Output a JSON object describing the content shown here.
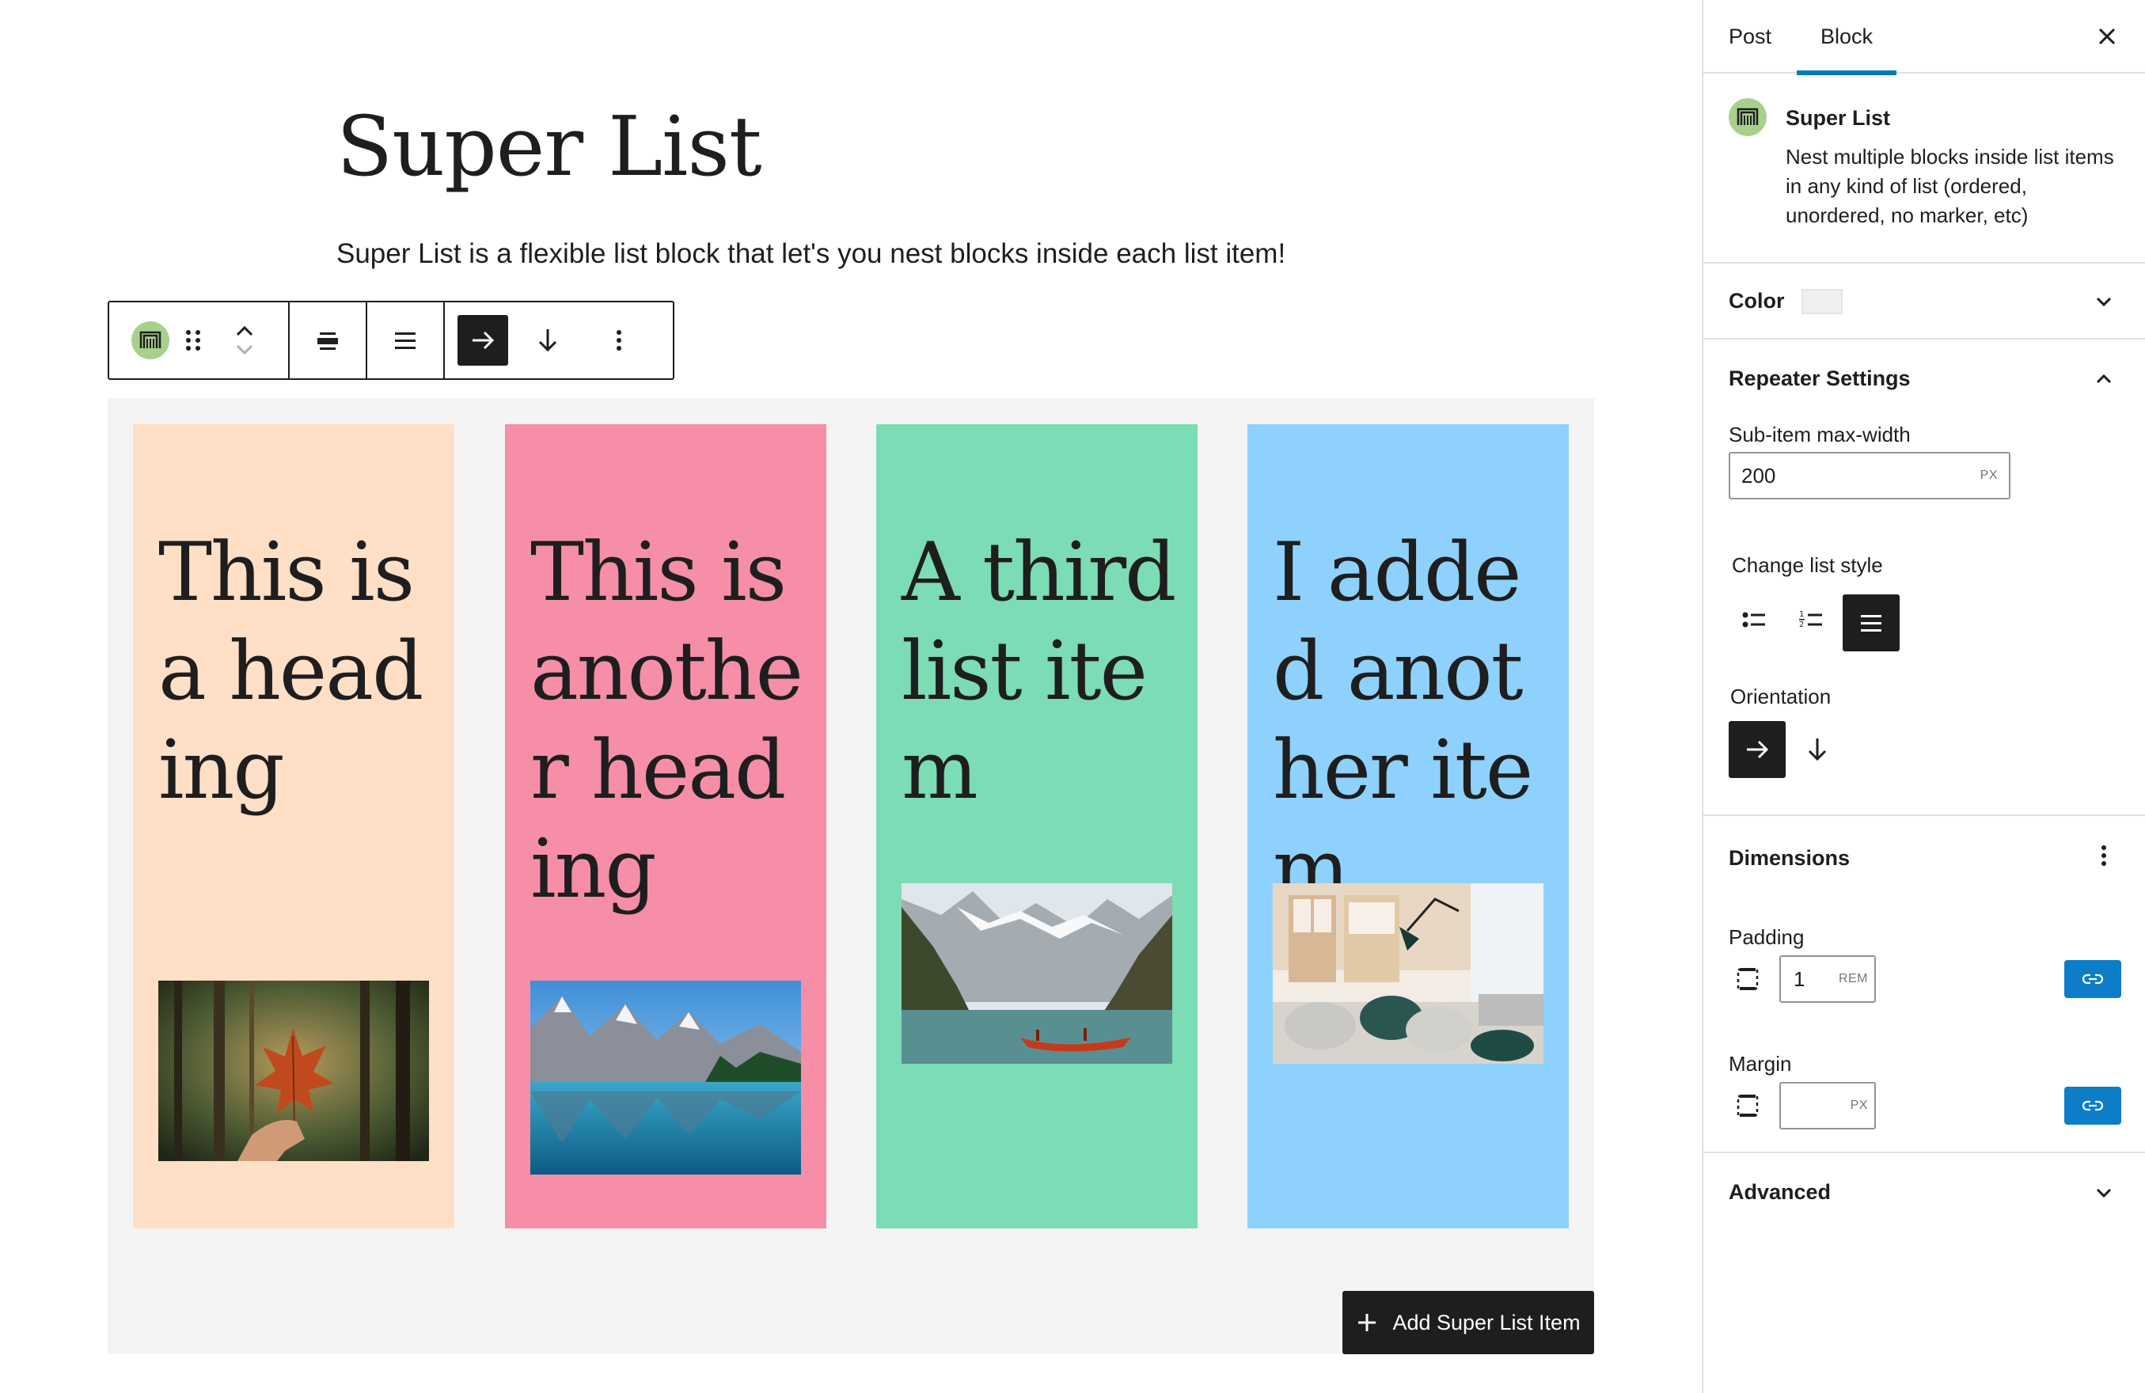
{
  "post": {
    "title": "Super List",
    "intro": "Super List is a flexible list block that let's you nest blocks inside each list item!"
  },
  "toolbar": {
    "block_icon": "super-list-icon",
    "buttons": [
      "drag-handle-icon",
      "move-up-icon",
      "move-down-icon",
      "align-icon",
      "list-style-icon",
      "orientation-horizontal-icon",
      "orientation-vertical-icon",
      "more-options-icon"
    ],
    "active_orientation": "horizontal"
  },
  "list_items": [
    {
      "heading": "This is a heading",
      "background": "#ffdfc6",
      "image": "autumn maple leaf held in hand in forest"
    },
    {
      "heading": "This is another heading",
      "background": "#f68ea8",
      "image": "mountain lake reflection"
    },
    {
      "heading": "A third list item",
      "background": "#7bdcb5",
      "image": "red canoe on mountain lake"
    },
    {
      "heading": "I added another item",
      "background": "#8ed1fc",
      "image": "bright interior with chairs and lamp"
    }
  ],
  "add_button": {
    "label": "Add Super List Item",
    "icon": "plus-icon"
  },
  "sidebar": {
    "tabs": [
      {
        "label": "Post",
        "active": false
      },
      {
        "label": "Block",
        "active": true
      }
    ],
    "close_icon": "close-icon",
    "block_card": {
      "title": "Super List",
      "description": "Nest multiple blocks inside list items in any kind of list (ordered, unordered, no marker, etc)"
    },
    "color_panel": {
      "label": "Color",
      "swatch": "#f0f0f0"
    },
    "repeater": {
      "label": "Repeater Settings",
      "max_width_label": "Sub-item max-width",
      "max_width_value": "200",
      "max_width_unit": "PX",
      "list_style_label": "Change list style",
      "list_styles": [
        "unordered-list-icon",
        "ordered-list-icon",
        "no-marker-list-icon"
      ],
      "active_list_style": "none",
      "orientation_label": "Orientation",
      "orientations": [
        "arrow-right-icon",
        "arrow-down-icon"
      ],
      "active_orientation": "horizontal"
    },
    "dimensions": {
      "label": "Dimensions",
      "padding_label": "Padding",
      "padding_value": "1",
      "padding_unit": "REM",
      "margin_label": "Margin",
      "margin_value": "",
      "margin_unit": "PX"
    },
    "advanced": {
      "label": "Advanced"
    }
  },
  "colors": {
    "accent": "#007cba",
    "link_button": "#0e7dc8",
    "dark": "#1e1e1e",
    "icon_green": "#a8d08d"
  }
}
